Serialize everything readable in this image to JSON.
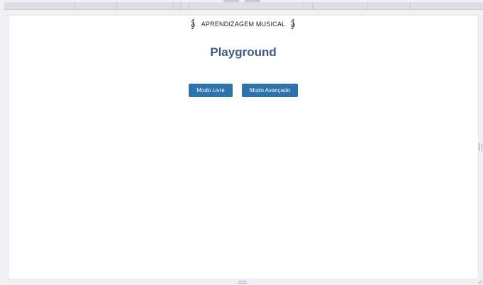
{
  "brand": {
    "text": "APRENDIZAGEM MUSICAL",
    "left_icon": "treble-clef-icon",
    "right_icon": "treble-clef-icon"
  },
  "page": {
    "title": "Playground"
  },
  "modes": {
    "free_label": "Modo Livre",
    "advanced_label": "Modo Avançado"
  },
  "colors": {
    "accent": "#2f73ad",
    "title": "#3d5a8a",
    "background": "#f0f1f3"
  }
}
